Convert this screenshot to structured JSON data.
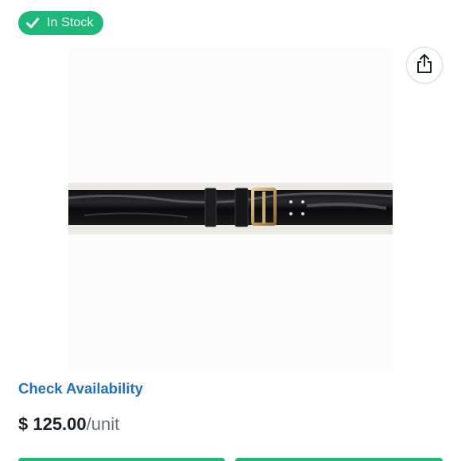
{
  "stock_badge": {
    "label": "In Stock",
    "icon": "check-icon",
    "color": "#1db97a"
  },
  "share": {
    "icon": "share-icon"
  },
  "product": {
    "image_icon": "leather-belt-image"
  },
  "availability": {
    "link_label": "Check Availability",
    "color": "#1f6fc9"
  },
  "price": {
    "amount": "$ 125.00",
    "unit": "/unit"
  },
  "actions": {
    "accent": "#1db97a"
  }
}
